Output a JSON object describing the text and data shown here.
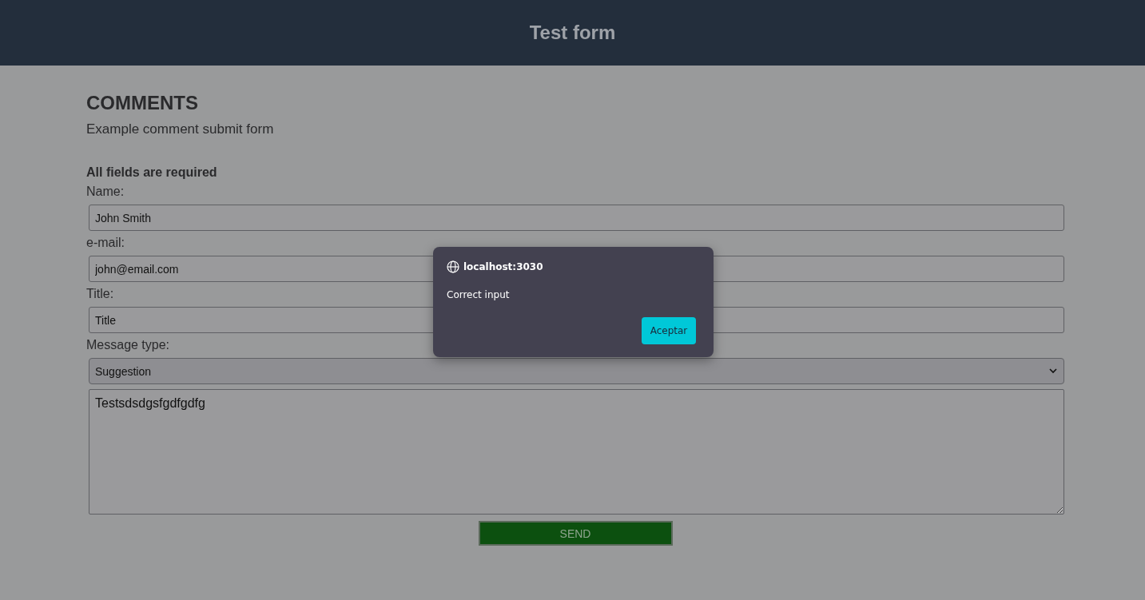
{
  "header": {
    "title": "Test form"
  },
  "heading": "COMMENTS",
  "subtitle": "Example comment submit form",
  "required_note": "All fields are required",
  "fields": [
    {
      "kind": "text",
      "label": "Name:",
      "value": "John Smith"
    },
    {
      "kind": "text",
      "label": "e-mail:",
      "value": "john@email.com"
    },
    {
      "kind": "text",
      "label": "Title:",
      "value": "Title"
    },
    {
      "kind": "select",
      "label": "Message type:",
      "value": "Suggestion"
    },
    {
      "kind": "textarea",
      "value": "Testsdsdgsfgdfgdfg"
    }
  ],
  "send_button": "SEND",
  "dialog": {
    "origin": "localhost:3030",
    "message": "Correct input",
    "button": "Aceptar"
  }
}
